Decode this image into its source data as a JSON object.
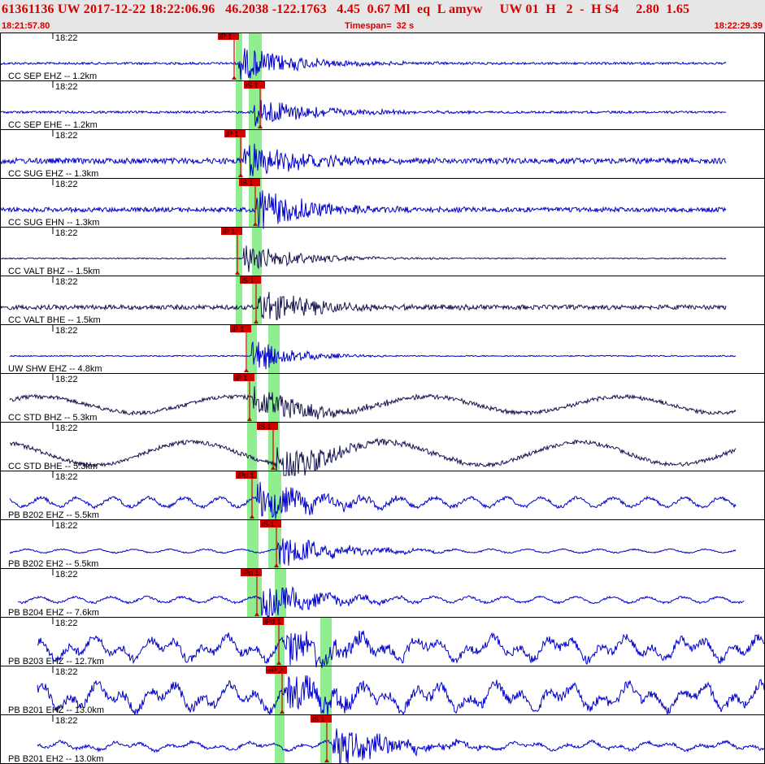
{
  "header": {
    "title": "61361136 UW 2017-12-22 18:22:06.96   46.2038 -122.1763   4.45  0.67 Ml  eq  L amyw     UW 01  H   2  -  H S4     2.80  1.65",
    "start_time": "18:21:57.80",
    "timespan": "Timespan=  32 s",
    "end_time": "18:22:29.39"
  },
  "colors": {
    "accent": "#d40000",
    "trace_blue": "#0000cc",
    "trace_dark": "#141450",
    "pick_window": "#90ee90",
    "header_bg": "#e6e6e6"
  },
  "channels": [
    {
      "label": "CC SEP EHZ -- 1.2km",
      "time": "18:22",
      "pick": "iP 1"
    },
    {
      "label": "CC SEP EHE -- 1.2km",
      "time": "18:22",
      "pick": "iS 1"
    },
    {
      "label": "CC SUG EHZ -- 1.3km",
      "time": "18:22",
      "pick": "iP 1"
    },
    {
      "label": "CC SUG EHN -- 1.3km",
      "time": "18:22",
      "pick": "iS 1"
    },
    {
      "label": "CC VALT BHZ -- 1.5km",
      "time": "18:22",
      "pick": "iP 1"
    },
    {
      "label": "CC VALT BHE -- 1.5km",
      "time": "18:22",
      "pick": "iS 1"
    },
    {
      "label": "UW SHW EHZ -- 4.8km",
      "time": "18:22",
      "pick": "iP 1"
    },
    {
      "label": "CC STD BHZ -- 5.3km",
      "time": "18:22",
      "pick": "iP 1"
    },
    {
      "label": "CC STD BHE -- 5.3km",
      "time": "18:22",
      "pick": "iS 1"
    },
    {
      "label": "PB B202 EHZ -- 5.5km",
      "time": "18:22",
      "pick": "iPd 1"
    },
    {
      "label": "PB B202 EH2 -- 5.5km",
      "time": "18:22",
      "pick": "iS 1"
    },
    {
      "label": "PB B204 EHZ -- 7.6km",
      "time": "18:22",
      "pick": "iPd 1"
    },
    {
      "label": "PB B203 EHZ -- 12.7km",
      "time": "18:22",
      "pick": "iPd 1"
    },
    {
      "label": "PB B201 EHZ -- 13.0km",
      "time": "18:22",
      "pick": "eP 2"
    },
    {
      "label": "PB B201 EH2 -- 13.0km",
      "time": "18:22",
      "pick": "iS 1"
    }
  ]
}
